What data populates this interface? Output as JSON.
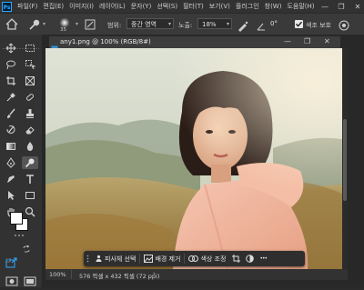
{
  "app": {
    "logo_text": "Ps"
  },
  "menu": {
    "items": [
      "파일(F)",
      "편집(E)",
      "이미지(I)",
      "레이어(L)",
      "문자(Y)",
      "선택(S)",
      "필터(T)",
      "보기(V)",
      "플러그인",
      "창(W)",
      "도움말(H)"
    ]
  },
  "window_controls": {
    "minimize": "—",
    "maximize": "❐",
    "close": "✕"
  },
  "options_bar": {
    "brush_size": "35",
    "range_label": "범위:",
    "range_value": "중간 영역",
    "exposure_label": "노출:",
    "exposure_value": "18%",
    "angle_value": "0°",
    "protect_tones_label": "색조 보호",
    "protect_tones_checked": true
  },
  "document": {
    "tab_title": "any1.png @ 100% (RGB/8#)",
    "zoom": "100%",
    "info": "576 픽셀 x 432 픽셀 (72 ppi)"
  },
  "context_bar": {
    "select_subject": "피사체 선택",
    "remove_background": "배경 제거",
    "color_adjust": "색상 조정",
    "more": "•••"
  },
  "colors": {
    "fg": "#ffffff",
    "bg": "#ffffff",
    "accent": "#31a8ff"
  }
}
